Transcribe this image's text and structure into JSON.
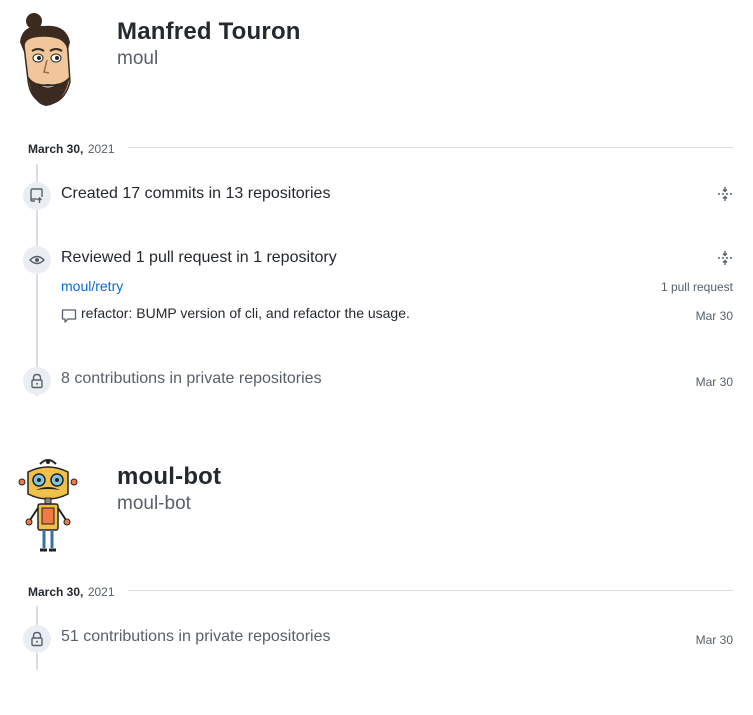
{
  "profiles": [
    {
      "name": "Manfred Touron",
      "login": "moul",
      "date": {
        "day": "March 30,",
        "year": "2021"
      },
      "activity": {
        "commits": {
          "title": "Created 17 commits in 13 repositories"
        },
        "reviews": {
          "title": "Reviewed 1 pull request in 1 repository",
          "repo": "moul/retry",
          "count_label": "1 pull request",
          "pr_title": "refactor: BUMP version of cli, and refactor the usage.",
          "pr_date": "Mar 30"
        },
        "private": {
          "title": "8 contributions in private repositories",
          "date": "Mar 30"
        }
      }
    },
    {
      "name": "moul-bot",
      "login": "moul-bot",
      "date": {
        "day": "March 30,",
        "year": "2021"
      },
      "activity": {
        "private": {
          "title": "51 contributions in private repositories",
          "date": "Mar 30"
        }
      }
    }
  ],
  "icons": {
    "commit": "repo-push-icon",
    "review": "eye-icon",
    "lock": "lock-icon",
    "fold": "fold-icon",
    "comment": "comment-icon"
  },
  "colors": {
    "link": "#0969da",
    "text": "#24292f",
    "muted": "#57606a",
    "badge_bg": "#eaeef2",
    "line": "#d8dee4"
  }
}
